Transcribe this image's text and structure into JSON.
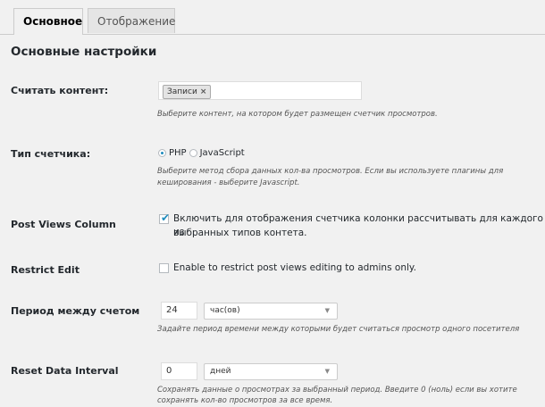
{
  "tabs": [
    {
      "label": "Основное",
      "active": true
    },
    {
      "label": "Отображение",
      "active": false
    }
  ],
  "section_title": "Основные настройки",
  "settings": {
    "count_content": {
      "label": "Считать контент:",
      "tags": [
        "Записи"
      ],
      "tag_remove_glyph": "×",
      "description": "Выберите контент, на котором будет размещен счетчик просмотров."
    },
    "counter_type": {
      "label": "Тип счетчика:",
      "options": [
        {
          "label": "PHP",
          "selected": true
        },
        {
          "label": "JavaScript",
          "selected": false
        }
      ],
      "description_line1": "Выберите метод сбора данных кол-ва просмотров. Если вы используете плагины для",
      "description_line2": "кеширования - выберите Javascript."
    },
    "post_views_column": {
      "label": "Post Views Column",
      "checked": true,
      "checkbox_line1": "Включить для отображения счетчика колонки рассчитывать для каждого из",
      "checkbox_line2": "выбранных типов контета."
    },
    "restrict_edit": {
      "label": "Restrict Edit",
      "checked": false,
      "checkbox_text": "Enable to restrict post views editing to admins only."
    },
    "time_between_counts": {
      "label": "Период между счетом",
      "value": "24",
      "unit": "час(ов)",
      "description": "Задайте период времени между которыми будет считаться просмотр одного посетителя"
    },
    "reset_data_interval": {
      "label": "Reset Data Interval",
      "value": "0",
      "unit": "дней",
      "description_line1": "Сохранять данные о просмотрах за выбранный период. Введите 0 (ноль) если вы хотите",
      "description_line2": "сохранять кол-во просмотров за все время."
    }
  },
  "icons": {
    "select_arrow": "▼",
    "check": "✔"
  },
  "colors": {
    "accent": "#1e8cbe",
    "background": "#f1f1f1"
  }
}
